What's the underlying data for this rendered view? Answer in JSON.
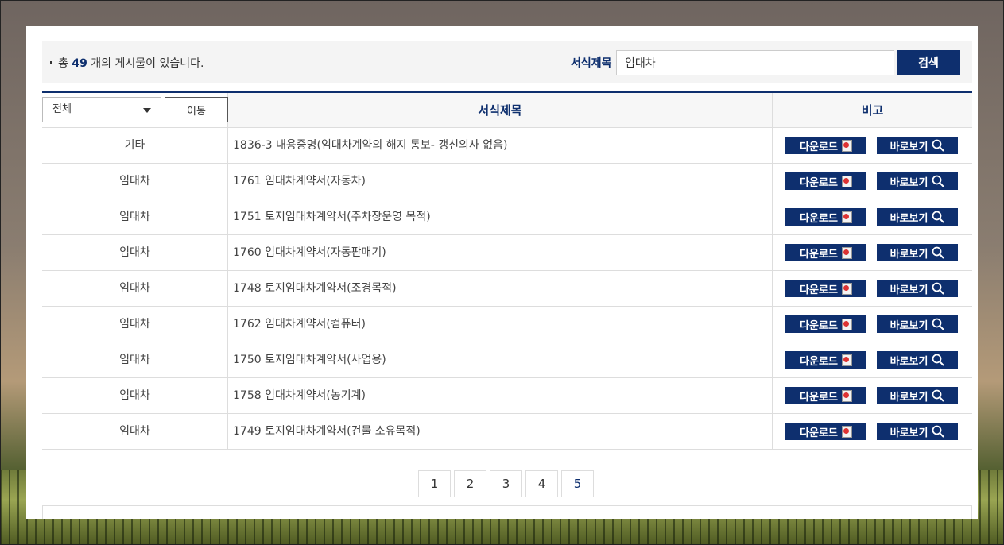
{
  "summary": {
    "prefix": "총",
    "count": "49",
    "suffix": "개의 게시물이 있습니다."
  },
  "search": {
    "label": "서식제목",
    "value": "임대차",
    "button": "검색"
  },
  "filter": {
    "selected": "전체",
    "move_button": "이동"
  },
  "table": {
    "headers": {
      "title": "서식제목",
      "note": "비고"
    },
    "download_label": "다운로드",
    "view_label": "바로보기",
    "rows": [
      {
        "category": "기타",
        "title": "1836-3 내용증명(임대차계약의 해지 통보- 갱신의사 없음)"
      },
      {
        "category": "임대차",
        "title": "1761 임대차계약서(자동차)"
      },
      {
        "category": "임대차",
        "title": "1751 토지임대차계약서(주차장운영 목적)"
      },
      {
        "category": "임대차",
        "title": "1760 임대차계약서(자동판매기)"
      },
      {
        "category": "임대차",
        "title": "1748 토지임대차계약서(조경목적)"
      },
      {
        "category": "임대차",
        "title": "1762 임대차계약서(컴퓨터)"
      },
      {
        "category": "임대차",
        "title": "1750 토지임대차계약서(사업용)"
      },
      {
        "category": "임대차",
        "title": "1758 임대차계약서(농기계)"
      },
      {
        "category": "임대차",
        "title": "1749 토지임대차계약서(건물 소유목적)"
      }
    ]
  },
  "pagination": {
    "pages": [
      "1",
      "2",
      "3",
      "4",
      "5"
    ],
    "current": "5"
  },
  "colors": {
    "primary": "#0e2f6e",
    "border": "#dddddd",
    "topbar_bg": "#f4f4f4"
  },
  "icons": {
    "download": "document-icon",
    "view": "search-icon",
    "select": "chevron-down-icon"
  }
}
